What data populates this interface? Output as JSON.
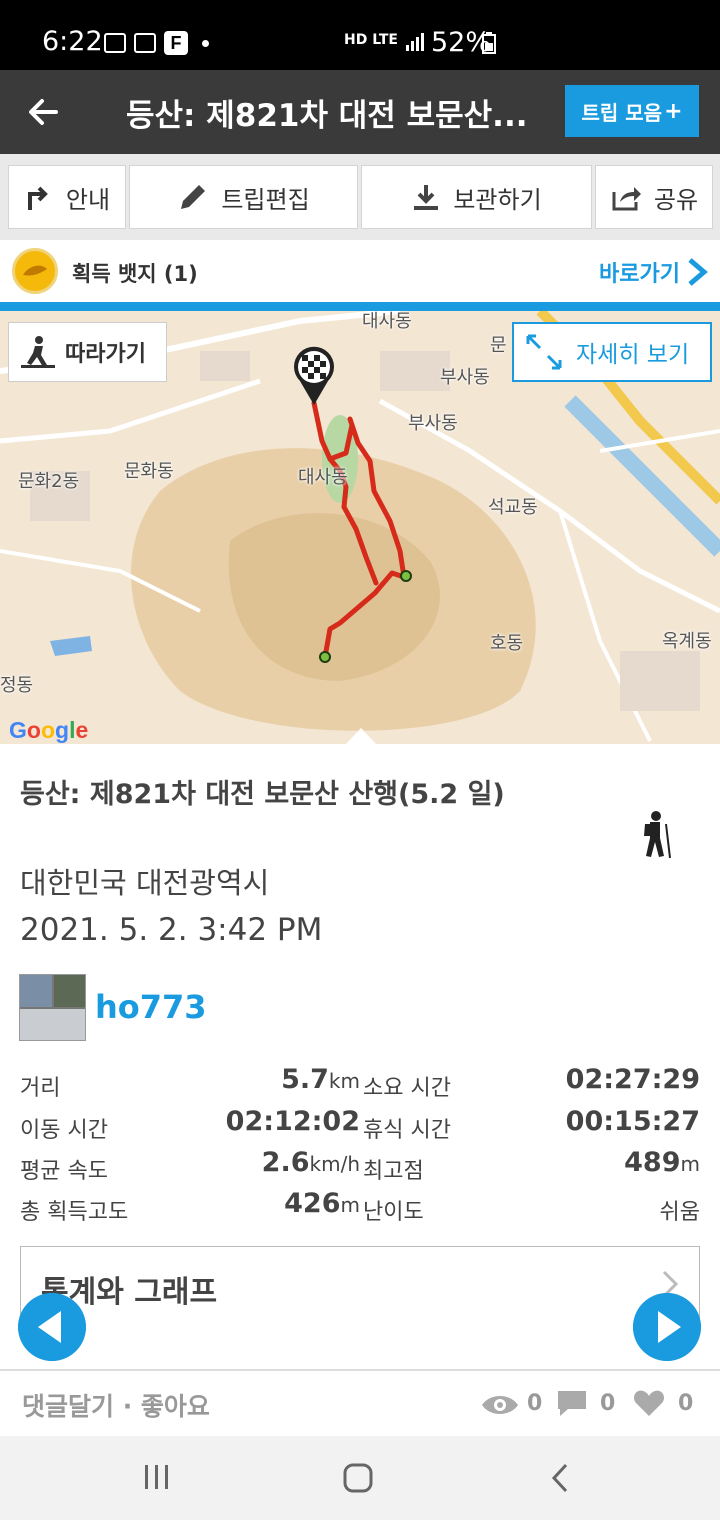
{
  "status_bar": {
    "time": "6:22",
    "network": "HD LTE",
    "battery": "52%"
  },
  "header": {
    "title": "등산: 제821차 대전 보문산...",
    "trip_collection": "트립 모음"
  },
  "actions": {
    "guide": "안내",
    "edit": "트립편집",
    "save": "보관하기",
    "share": "공유"
  },
  "badge": {
    "text": "획득 뱃지 (1)",
    "goto": "바로가기"
  },
  "map": {
    "follow": "따라가기",
    "detail": "자세히 보기",
    "labels": [
      "대사동",
      "부사동",
      "부사동",
      "문",
      "문화2동",
      "문화동",
      "대사동",
      "석교동",
      "호동",
      "옥계동",
      "정동"
    ],
    "google": "Google"
  },
  "trip": {
    "title": "등산: 제821차 대전 보문산 산행(5.2 일)",
    "location": "대한민국 대전광역시",
    "datetime": "2021. 5. 2. 3:42 PM",
    "username": "ho773"
  },
  "stats": [
    {
      "label": "거리",
      "value": "5.7",
      "unit": "km",
      "label2": "소요 시간",
      "value2": "02:27:29",
      "unit2": ""
    },
    {
      "label": "이동 시간",
      "value": "02:12:02",
      "unit": "",
      "label2": "휴식 시간",
      "value2": "00:15:27",
      "unit2": ""
    },
    {
      "label": "평균 속도",
      "value": "2.6",
      "unit": "km/h",
      "label2": "최고점",
      "value2": "489",
      "unit2": "m"
    },
    {
      "label": "총 획득고도",
      "value": "426",
      "unit": "m",
      "label2": "난이도",
      "value2": "쉬움",
      "unit2": ""
    }
  ],
  "stats_graph": "통계와 그래프",
  "footer": {
    "comments_likes": "댓글달기 · 좋아요",
    "views": "0",
    "comments": "0",
    "likes": "0"
  },
  "colors": {
    "accent": "#1a9be0",
    "route": "#d62a1a",
    "header_bg": "#3a3a3a"
  }
}
